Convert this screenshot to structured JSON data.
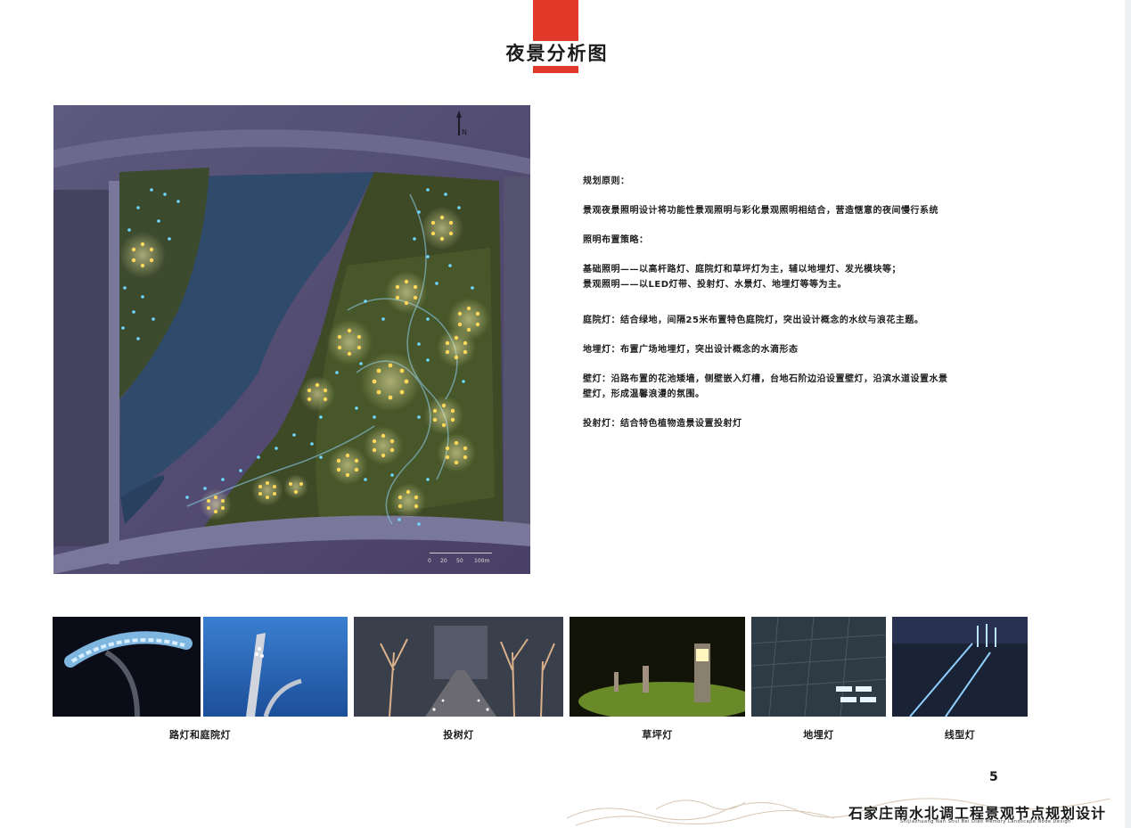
{
  "header": {
    "title": "夜景分析图"
  },
  "map": {
    "north_label": "N",
    "scale_labels": [
      "0",
      "20",
      "50",
      "100m"
    ]
  },
  "text": {
    "heading1": "规划原则：",
    "principle": "景观夜景照明设计将功能性景观照明与彩化景观照明相结合，营造惬意的夜间慢行系统",
    "heading2": "照明布置策略：",
    "strategy1": "基础照明——以高杆路灯、庭院灯和草坪灯为主，辅以地埋灯、发光模块等；",
    "strategy2": "景观照明——以LED灯带、投射灯、水景灯、地埋灯等等为主。",
    "courtyard": "庭院灯：结合绿地，间隔25米布置特色庭院灯，突出设计概念的水纹与浪花主题。",
    "inground": "地埋灯：布置广场地埋灯，突出设计概念的水滴形态",
    "wall1": "壁灯：沿路布置的花池矮墙，侧壁嵌入灯槽，台地石阶边沿设置壁灯，沿滨水道设置水景",
    "wall2": "壁灯，形成温馨浪漫的氛围。",
    "projection": "投射灯：结合特色植物造景设置投射灯"
  },
  "captions": {
    "street": "路灯和庭院灯",
    "tree": "投树灯",
    "lawn": "草坪灯",
    "ground": "地埋灯",
    "linear": "线型灯"
  },
  "footer": {
    "page_number": "5",
    "title": "石家庄南水北调工程景观节点规划设计",
    "subtitle": "Shijiazhuang Nan Shui Bei Diao Memory Landscape Node Design"
  },
  "colors": {
    "accent": "#e23a2a",
    "map_bg": "#5a5478",
    "water": "#2f4a6a",
    "warm_light": "#ffd85a",
    "cool_light": "#6fd8ff"
  }
}
